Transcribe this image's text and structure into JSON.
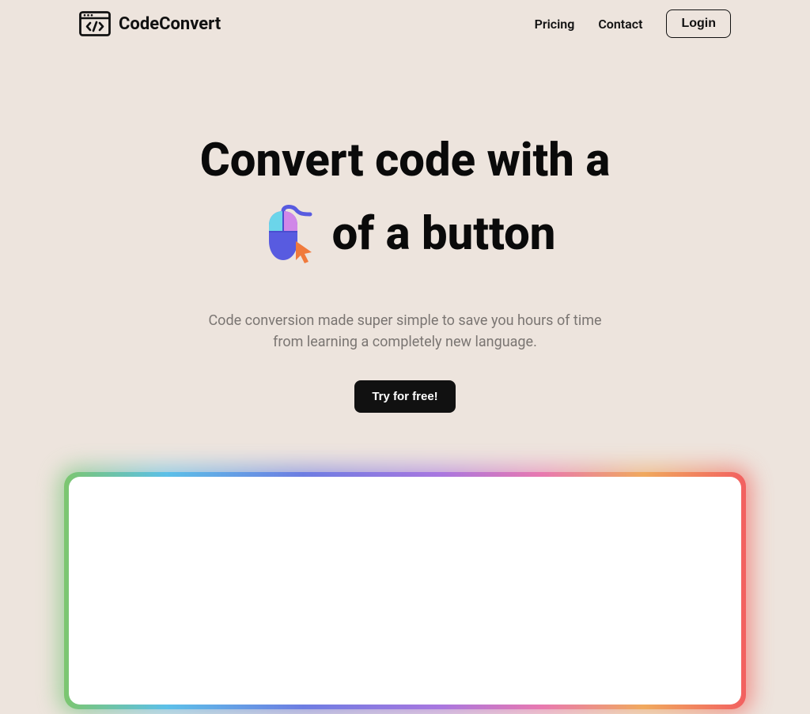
{
  "brand": {
    "name": "CodeConvert"
  },
  "nav": {
    "pricing": "Pricing",
    "contact": "Contact",
    "login": "Login"
  },
  "hero": {
    "line1": "Convert code with a",
    "line2": "of a button",
    "sub1": "Code conversion made super simple to save you hours of time",
    "sub2": "from learning a completely new language.",
    "cta": "Try for free!"
  }
}
